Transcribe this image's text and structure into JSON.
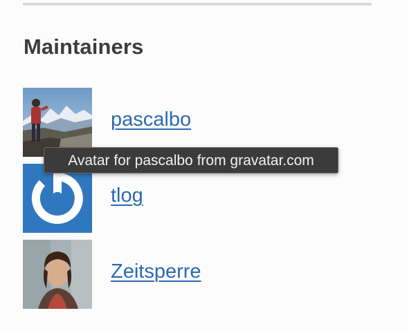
{
  "section": {
    "title": "Maintainers"
  },
  "maintainers": [
    {
      "name": "pascalbo",
      "avatar_icon": "mountain-photo-avatar"
    },
    {
      "name": "tlog",
      "avatar_icon": "gravatar-logo-avatar",
      "avatar_color": "#2f78bf"
    },
    {
      "name": "Zeitsperre",
      "avatar_icon": "portrait-photo-avatar"
    }
  ],
  "tooltip": {
    "text": "Avatar for pascalbo from gravatar.com"
  }
}
